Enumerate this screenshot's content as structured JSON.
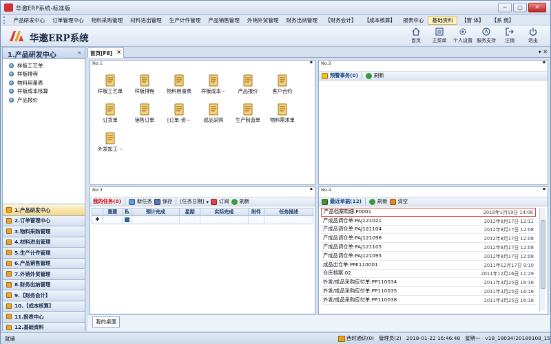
{
  "window": {
    "title": "华邀ERP系统-标准版"
  },
  "menu": [
    "产品研发中心",
    "订单管理中心",
    "物料采购管理",
    "材料进出管理",
    "生产计件管理",
    "产品销售管理",
    "外销外贸管理",
    "财务出纳管理",
    "【财务会计】",
    "【成本核算】",
    "报表中心",
    "基础资料",
    "【窗 体】",
    "【系 统】"
  ],
  "brand": "华邀ERP系统",
  "toolbar": {
    "home": "首页",
    "mainmenu": "主菜单",
    "personal": "个人设置",
    "support": "服务支持",
    "logout": "注销",
    "exit": "退出"
  },
  "left": {
    "title": "1.产品研发中心",
    "collapse": "«",
    "items": [
      "样板工艺单",
      "样板排程",
      "物料用量表",
      "样板成本核算",
      "产品报价"
    ],
    "modules": [
      "1.产品研发中心",
      "2.订单管理中心",
      "3.物料采购管理",
      "4.材料进出管理",
      "5.生产计件管理",
      "6.产品销售管理",
      "7.外销外贸管理",
      "8.财务出纳管理",
      "9.【财务会计】",
      "10.【成本核算】",
      "11.报表中心",
      "12.基础资料"
    ]
  },
  "tab": {
    "label": "首页[F8]",
    "close": "×",
    "right": "▾ ✕"
  },
  "panel1": {
    "header": "No.1",
    "icons": [
      "样板工艺单",
      "样板排程",
      "物料用量表",
      "样板成本⋯",
      "产品报价",
      "客户合约",
      "订货单",
      "销售订单",
      "[订单-资⋯",
      "成品采购",
      "生产制造单",
      "物料需求单",
      "外发加工⋯"
    ]
  },
  "panel2": {
    "header": "No.2",
    "warning": "预警事务(0)",
    "refresh": "刷新"
  },
  "panel3": {
    "header": "No.3",
    "tasks": "我的任务(0)",
    "newtask": "新任务",
    "save": "保存",
    "taskdate": "[任务日期]",
    "subscribe": "订阅",
    "refresh": "刷新",
    "columns": [
      "重要",
      "私",
      "预计完成",
      "星期",
      "实际完成",
      "附件",
      "任务描述"
    ],
    "newrow": "✱"
  },
  "panel4": {
    "header": "No.4",
    "recent": "最近单据(12)",
    "refresh": "刷新",
    "clear": "清空",
    "rows": [
      {
        "name": "产品档案明细:P0001",
        "date": "2018年1月19日 14:08"
      },
      {
        "name": "产成品调仓单:PAJ121021",
        "date": "2012年8月17日 12:11"
      },
      {
        "name": "产成品调仓单:PAJ121104",
        "date": "2012年8月17日 12:08"
      },
      {
        "name": "产成品调仓单:PAJ121098",
        "date": "2012年8月17日 12:08"
      },
      {
        "name": "产成品调仓单:PAJ121105",
        "date": "2012年8月17日 12:08"
      },
      {
        "name": "产成品调仓单:PAJ121095",
        "date": "2012年8月17日 12:08"
      },
      {
        "name": "成品出仓单:PMI110001",
        "date": "2011年12月17日 9:10"
      },
      {
        "name": "仓库档案:02",
        "date": "2011年12月16日 11:29"
      },
      {
        "name": "外发/成品采购应付单:PP110034",
        "date": "2011年3月25日 16:16"
      },
      {
        "name": "外发/成品采购应付单:PP110035",
        "date": "2011年3月25日 16:16"
      },
      {
        "name": "外发/成品采购应付单:PP110038",
        "date": "2011年3月25日 16:16"
      }
    ]
  },
  "desk": "我的桌面",
  "status": {
    "left": "就绪",
    "message": "西时通讯(0)",
    "user": "管理员(2)",
    "datetime": "2018-01-22  16:46:48",
    "weekday": "星期一",
    "version": "v18_18034(20180108_15)"
  },
  "colors": {
    "accent": "#1c2d4a",
    "warning_red": "#cc0000",
    "highlight": "#fff3c2"
  }
}
